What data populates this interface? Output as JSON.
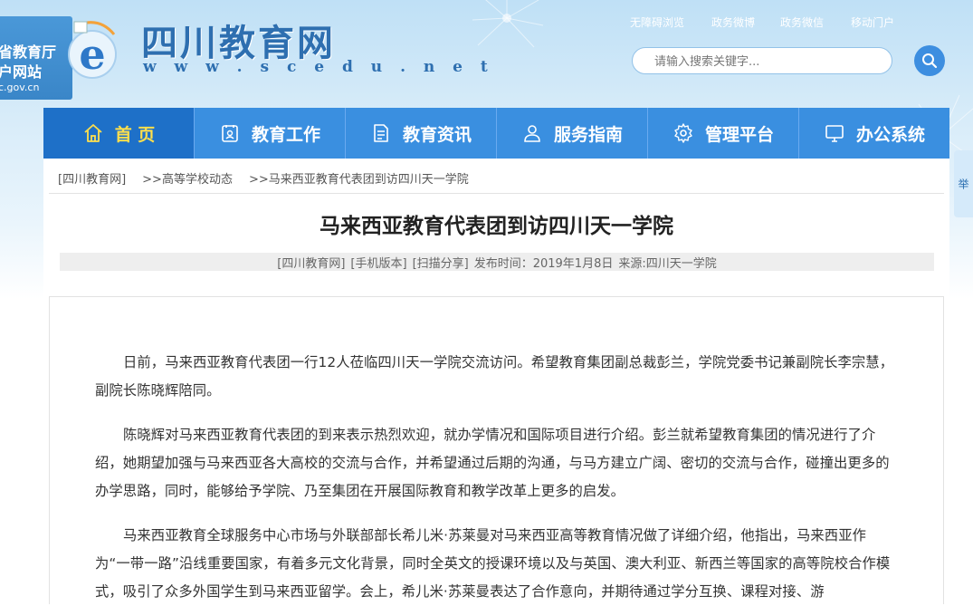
{
  "header": {
    "gov_badge": {
      "line1": "省教育厅",
      "line2": "户网站",
      "line3": "c.gov.cn"
    },
    "logo_letter": "e",
    "site_name": "四川教育网",
    "site_url": "w w w . s c e d u . n e t",
    "top_links": [
      "无障碍浏览",
      "政务微博",
      "政务微信",
      "移动门户"
    ],
    "search": {
      "placeholder": "请输入搜索关键字..."
    }
  },
  "nav": {
    "items": [
      {
        "label": "首 页",
        "icon": "home-icon"
      },
      {
        "label": "教育工作",
        "icon": "document-icon"
      },
      {
        "label": "教育资讯",
        "icon": "news-icon"
      },
      {
        "label": "服务指南",
        "icon": "person-icon"
      },
      {
        "label": "管理平台",
        "icon": "gear-icon"
      },
      {
        "label": "办公系统",
        "icon": "monitor-icon"
      }
    ]
  },
  "side_tab": "举",
  "breadcrumb": [
    "[四川教育网]",
    ">>高等学校动态",
    ">>马来西亚教育代表团到访四川天一学院"
  ],
  "article": {
    "title": "马来西亚教育代表团到访四川天一学院",
    "meta": {
      "site": "[四川教育网]",
      "mobile": "[手机版本]",
      "share": "[扫描分享]",
      "published": "发布时间：2019年1月8日",
      "source": "来源:四川天一学院"
    },
    "paragraphs": [
      "日前，马来西亚教育代表团一行12人莅临四川天一学院交流访问。希望教育集团副总裁彭兰，学院党委书记兼副院长李宗慧，副院长陈晓辉陪同。",
      "陈晓辉对马来西亚教育代表团的到来表示热烈欢迎，就办学情况和国际项目进行介绍。彭兰就希望教育集团的情况进行了介绍，她期望加强与马来西亚各大高校的交流与合作，并希望通过后期的沟通，与马方建立广阔、密切的交流与合作，碰撞出更多的办学思路，同时，能够给予学院、乃至集团在开展国际教育和教学改革上更多的启发。",
      "马来西亚教育全球服务中心市场与外联部部长希儿米·苏莱曼对马来西亚高等教育情况做了详细介绍，他指出，马来西亚作为“一带一路”沿线重要国家，有着多元文化背景，同时全英文的授课环境以及与英国、澳大利亚、新西兰等国家的高等院校合作模式，吸引了众多外国学生到马来西亚留学。会上，希儿米·苏莱曼表达了合作意向，并期待通过学分互换、课程对接、游"
    ]
  },
  "colors": {
    "nav_bg": "#3a8fe0",
    "nav_active_bg": "#1e70c8",
    "nav_active_text": "#ffdf4c",
    "brand_blue": "#2e6fb0"
  }
}
